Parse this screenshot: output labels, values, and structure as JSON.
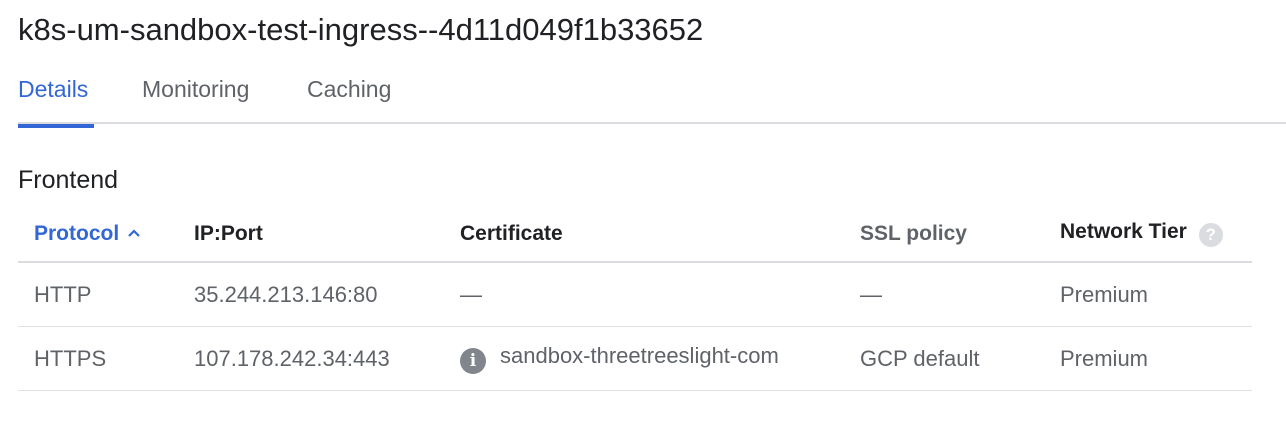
{
  "page": {
    "title": "k8s-um-sandbox-test-ingress--4d11d049f1b33652"
  },
  "tabs": [
    {
      "label": "Details",
      "active": true
    },
    {
      "label": "Monitoring",
      "active": false
    },
    {
      "label": "Caching",
      "active": false
    }
  ],
  "frontend": {
    "section_title": "Frontend",
    "columns": {
      "protocol": "Protocol",
      "ip_port": "IP:Port",
      "certificate": "Certificate",
      "ssl_policy": "SSL policy",
      "network_tier": "Network Tier"
    },
    "sort": {
      "column": "protocol",
      "direction": "ascending",
      "icon": "chevron-up-icon"
    },
    "help_icon": "?",
    "rows": [
      {
        "protocol": "HTTP",
        "ip_port": "35.244.213.146:80",
        "certificate": "—",
        "certificate_icon": "",
        "ssl_policy": "—",
        "network_tier": "Premium"
      },
      {
        "protocol": "HTTPS",
        "ip_port": "107.178.242.34:443",
        "certificate": "sandbox-threetreeslight-com",
        "certificate_icon": "info-icon",
        "ssl_policy": "GCP default",
        "network_tier": "Premium"
      }
    ]
  },
  "colors": {
    "accent": "#3367d6",
    "text_primary": "#202124",
    "text_secondary": "#5f6368",
    "divider": "#dadce0"
  }
}
